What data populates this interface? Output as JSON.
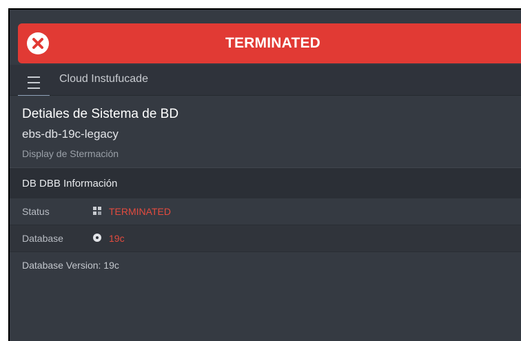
{
  "banner": {
    "title": "TERMINATED",
    "icon": "close-circle-icon",
    "color": "#e13a34"
  },
  "nav": {
    "menu_icon": "hamburger-menu-icon",
    "title": "Cloud Instufucade"
  },
  "details": {
    "title": "Detiales de Sistema de BD",
    "name": "ebs-db-19c-legacy",
    "subtitle": "Display de Stermación"
  },
  "section": {
    "label": "DB DBB Información"
  },
  "rows": [
    {
      "label": "Status",
      "icon": "status-icon",
      "value": "TERMINATED"
    },
    {
      "label": "Database",
      "icon": "database-icon",
      "value": "19c"
    }
  ],
  "version_text": "Database Version: 19c",
  "colors": {
    "accent_red": "#e24b3f",
    "background": "#353a42"
  }
}
